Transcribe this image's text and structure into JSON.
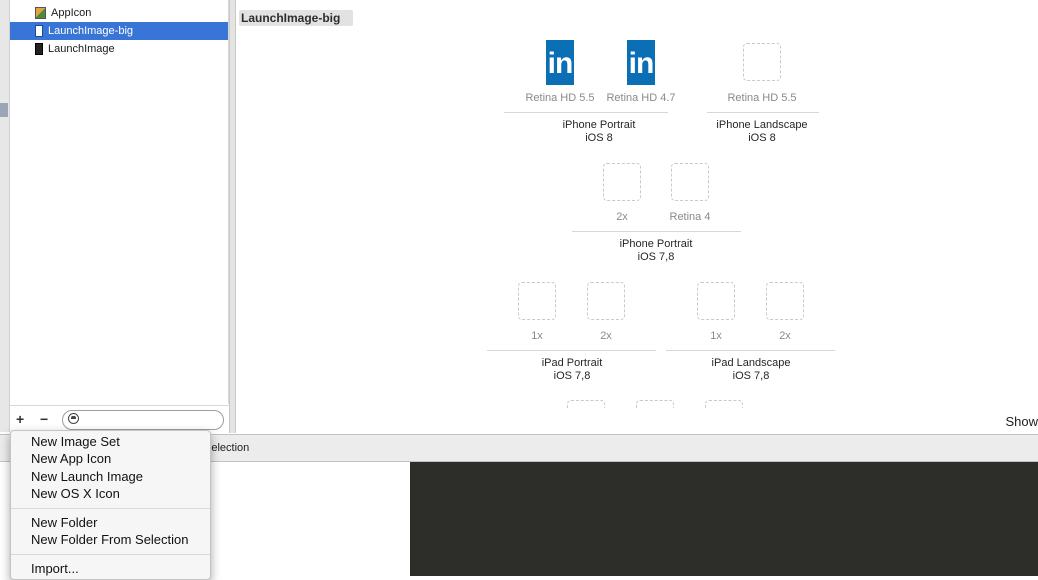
{
  "asset_list": {
    "items": [
      {
        "label": "AppIcon",
        "icon": "app-icon-thumbnail",
        "selected": false
      },
      {
        "label": "LaunchImage-big",
        "icon": "launch-image-thumbnail",
        "selected": true
      },
      {
        "label": "LaunchImage",
        "icon": "launch-image-thumbnail",
        "selected": false
      }
    ],
    "add_button": "+",
    "remove_button": "−"
  },
  "editor": {
    "title": "LaunchImage-big",
    "show_label": "Show",
    "logo_text": "in",
    "slots": {
      "s1": "Retina HD 5.5",
      "s2": "Retina HD 4.7",
      "s3": "Retina HD 5.5",
      "s4": "2x",
      "s5": "Retina 4",
      "s6": "1x",
      "s7": "2x",
      "s8": "1x",
      "s9": "2x"
    },
    "groups": {
      "g1": {
        "name": "iPhone Portrait",
        "os": "iOS 8"
      },
      "g2": {
        "name": "iPhone Landscape",
        "os": "iOS 8"
      },
      "g3": {
        "name": "iPhone Portrait",
        "os": "iOS 7,8"
      },
      "g4": {
        "name": "iPad Portrait",
        "os": "iOS 7,8"
      },
      "g5": {
        "name": "iPad Landscape",
        "os": "iOS 7,8"
      }
    }
  },
  "bottom_bar": {
    "partial_label": "Selection"
  },
  "menu": {
    "items": [
      "New Image Set",
      "New App Icon",
      "New Launch Image",
      "New OS X Icon",
      "New Folder",
      "New Folder From Selection",
      "Import..."
    ]
  },
  "colors": {
    "selection": "#3875d7",
    "linkedin_blue": "#0b6fb5",
    "console_background": "#2d2d29"
  }
}
